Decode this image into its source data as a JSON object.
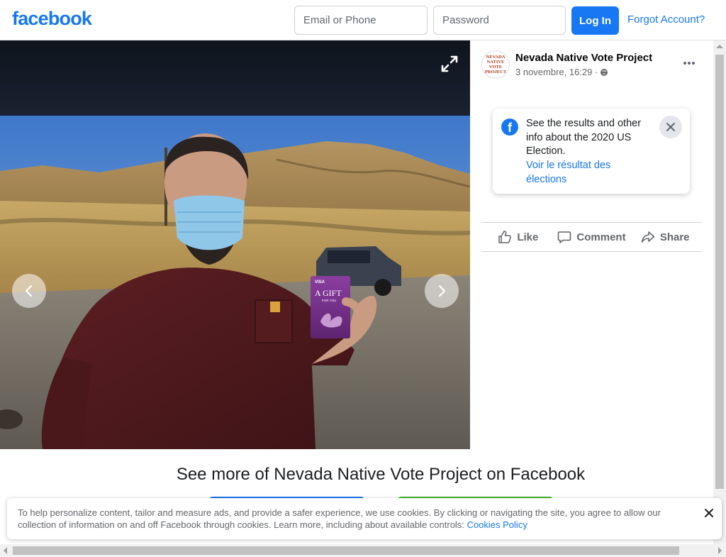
{
  "header": {
    "logo": "facebook",
    "email_placeholder": "Email or Phone",
    "password_placeholder": "Password",
    "login_label": "Log In",
    "forgot_label": "Forgot Account?"
  },
  "post": {
    "page_name": "Nevada Native Vote Project",
    "avatar_text": [
      "NEVADA",
      "NATIVE",
      "VOTE",
      "PROJECT"
    ],
    "date": "3 novembre, 16:29 ·",
    "election_info": {
      "text": "See the results and other info about the 2020 US Election.",
      "link": "Voir le résultat des élections"
    },
    "actions": {
      "like": "Like",
      "comment": "Comment",
      "share": "Share"
    }
  },
  "photo": {
    "gift_card_brand": "VISA",
    "gift_card_title": "A GIFT",
    "gift_card_sub": "FOR YOU"
  },
  "see_more": {
    "title": "See more of Nevada Native Vote Project on Facebook"
  },
  "cookie_banner": {
    "text": "To help personalize content, tailor and measure ads, and provide a safer experience, we use cookies. By clicking or navigating the site, you agree to allow our collection of information on and off Facebook through cookies. Learn more, including about available controls:",
    "link": "Cookies Policy"
  },
  "colors": {
    "brand": "#1877f2",
    "create_account": "#42b72a",
    "muted_text": "#65676b"
  },
  "icons": [
    "expand-icon",
    "chevron-left-icon",
    "chevron-right-icon",
    "globe-icon",
    "more-horizontal-icon",
    "facebook-logo-icon",
    "close-icon",
    "like-icon",
    "comment-icon",
    "share-icon"
  ]
}
